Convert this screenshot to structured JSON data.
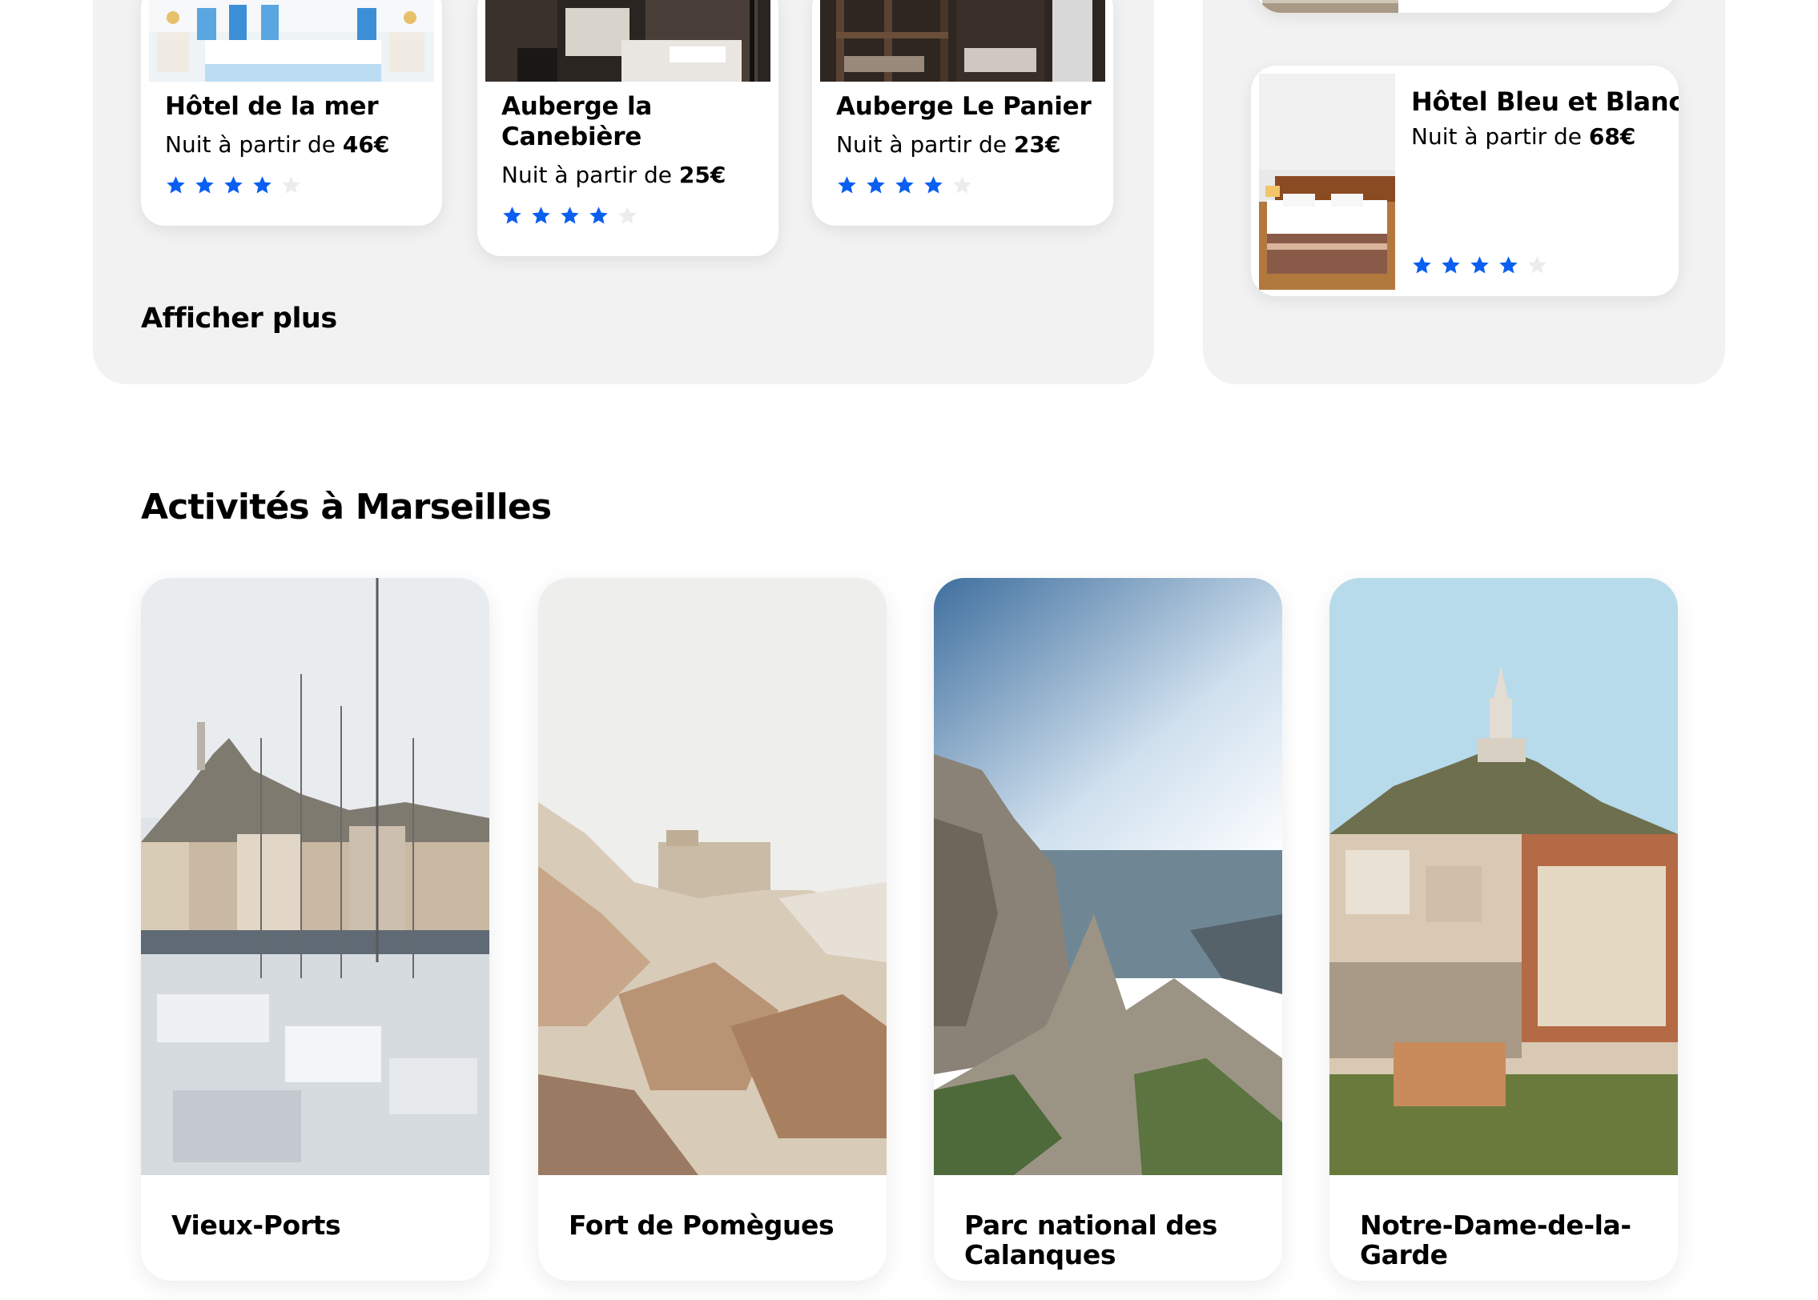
{
  "hotels": [
    {
      "name": "Hôtel de la mer",
      "price_prefix": "Nuit à partir de ",
      "price": "46€",
      "rating": 4,
      "photo": "hotel-room-blue-photo"
    },
    {
      "name": "Auberge la Canebière",
      "price_prefix": "Nuit à partir de ",
      "price": "25€",
      "rating": 4,
      "photo": "hostel-room-photo"
    },
    {
      "name": "Auberge Le Panier",
      "price_prefix": "Nuit à partir de ",
      "price": "23€",
      "rating": 4,
      "photo": "bunk-beds-photo"
    }
  ],
  "featured_hotel": {
    "name": "Hôtel Bleu et Blanc",
    "price_prefix": "Nuit à partir de ",
    "price": "68€",
    "rating": 4,
    "photo": "hotel-bedroom-photo"
  },
  "show_more_label": "Afficher plus",
  "activities_title": "Activités à Marseilles",
  "activities": [
    {
      "label": "Vieux-Ports",
      "photo": "harbor-boats-photo"
    },
    {
      "label": "Fort de Pomègues",
      "photo": "fort-rocks-photo"
    },
    {
      "label": "Parc national des Calanques",
      "photo": "calanques-cliffs-photo"
    },
    {
      "label": "Notre-Dame-de-la-Garde",
      "photo": "basilica-city-photo"
    }
  ],
  "colors": {
    "star_active": "#0a5ff0",
    "star_inactive": "#ececec",
    "panel_bg": "#f2f2f2"
  }
}
